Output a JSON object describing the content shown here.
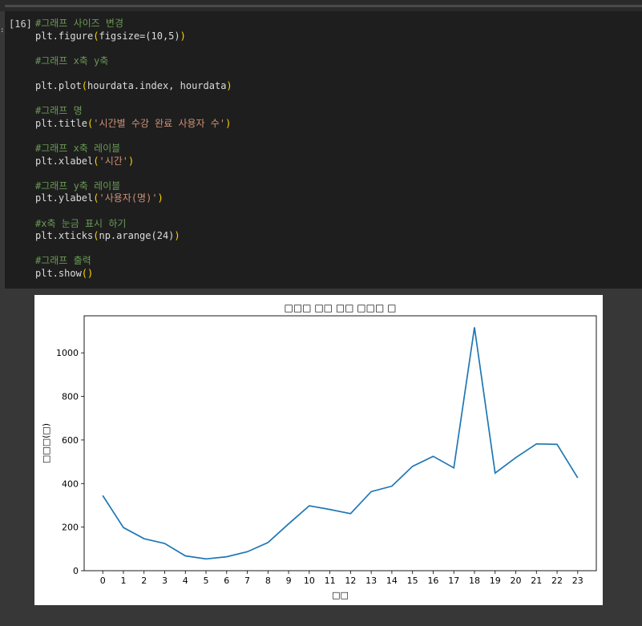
{
  "cell": {
    "prompt": "[16]",
    "lines": [
      [
        {
          "t": "cmt",
          "v": "#그래프 사이즈 변경"
        }
      ],
      [
        {
          "t": "fn",
          "v": "plt.figure"
        },
        {
          "t": "par",
          "v": "("
        },
        {
          "t": "fn",
          "v": "figsize=(10,5)"
        },
        {
          "t": "par",
          "v": ")"
        }
      ],
      [],
      [
        {
          "t": "cmt",
          "v": "#그래프 x축 y축"
        }
      ],
      [],
      [
        {
          "t": "fn",
          "v": "plt.plot"
        },
        {
          "t": "par",
          "v": "("
        },
        {
          "t": "fn",
          "v": "hourdata.index, hourdata"
        },
        {
          "t": "par",
          "v": ")"
        }
      ],
      [],
      [
        {
          "t": "cmt",
          "v": "#그래프 명"
        }
      ],
      [
        {
          "t": "fn",
          "v": "plt.title"
        },
        {
          "t": "par",
          "v": "("
        },
        {
          "t": "str",
          "v": "'시간별 수강 완료 사용자 수'"
        },
        {
          "t": "par",
          "v": ")"
        }
      ],
      [],
      [
        {
          "t": "cmt",
          "v": "#그래프 x축 레이블"
        }
      ],
      [
        {
          "t": "fn",
          "v": "plt.xlabel"
        },
        {
          "t": "par",
          "v": "("
        },
        {
          "t": "str",
          "v": "'시간'"
        },
        {
          "t": "par",
          "v": ")"
        }
      ],
      [],
      [
        {
          "t": "cmt",
          "v": "#그래프 y축 레이블"
        }
      ],
      [
        {
          "t": "fn",
          "v": "plt.ylabel"
        },
        {
          "t": "par",
          "v": "("
        },
        {
          "t": "str",
          "v": "'사용자(명)'"
        },
        {
          "t": "par",
          "v": ")"
        }
      ],
      [],
      [
        {
          "t": "cmt",
          "v": "#x축 눈금 표시 하기"
        }
      ],
      [
        {
          "t": "fn",
          "v": "plt.xticks"
        },
        {
          "t": "par",
          "v": "("
        },
        {
          "t": "fn",
          "v": "np.arange(24)"
        },
        {
          "t": "par",
          "v": ")"
        }
      ],
      [],
      [
        {
          "t": "cmt",
          "v": "#그래프 출력"
        }
      ],
      [
        {
          "t": "fn",
          "v": "plt.show"
        },
        {
          "t": "par",
          "v": "()"
        }
      ]
    ]
  },
  "chart_data": {
    "type": "line",
    "title": "□□□ □□ □□ □□□ □",
    "xlabel": "□□",
    "ylabel": "□□□(□)",
    "x": [
      0,
      1,
      2,
      3,
      4,
      5,
      6,
      7,
      8,
      9,
      10,
      11,
      12,
      13,
      14,
      15,
      16,
      17,
      18,
      19,
      20,
      21,
      22,
      23
    ],
    "values": [
      345,
      198,
      147,
      125,
      68,
      54,
      64,
      87,
      129,
      215,
      298,
      281,
      262,
      363,
      388,
      479,
      525,
      472,
      1117,
      448,
      519,
      582,
      580,
      426
    ],
    "ylim": [
      0,
      1170
    ],
    "yticks": [
      0,
      200,
      400,
      600,
      800,
      1000
    ],
    "xticks": [
      "0",
      "1",
      "2",
      "3",
      "4",
      "5",
      "6",
      "7",
      "8",
      "9",
      "10",
      "11",
      "12",
      "13",
      "14",
      "15",
      "16",
      "17",
      "18",
      "19",
      "20",
      "21",
      "22",
      "23"
    ],
    "line_color": "#1f77b4",
    "grid": false
  }
}
